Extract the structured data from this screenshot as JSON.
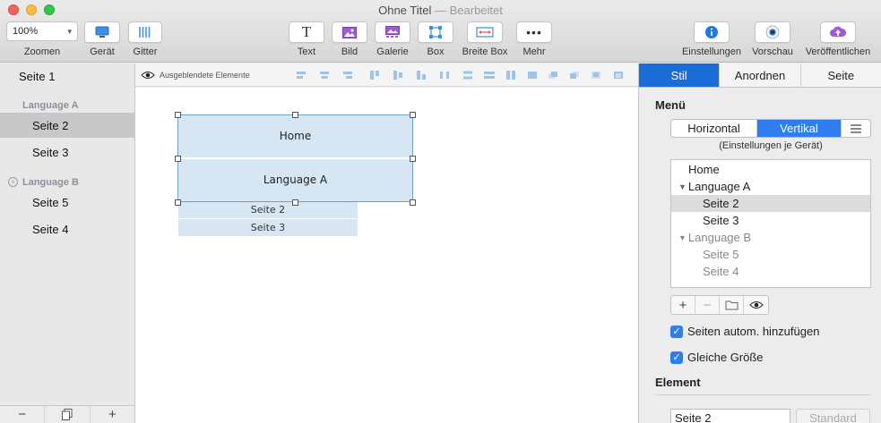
{
  "window": {
    "title": "Ohne Titel",
    "title_sep": " — ",
    "status": "Bearbeitet"
  },
  "toolbar": {
    "zoom_value": "100%",
    "zoom_label": "Zoomen",
    "device_label": "Gerät",
    "grid_label": "Gitter",
    "text_label": "Text",
    "image_label": "Bild",
    "gallery_label": "Galerie",
    "box_label": "Box",
    "wide_box_label": "Breite Box",
    "more_label": "Mehr",
    "settings_label": "Einstellungen",
    "preview_label": "Vorschau",
    "publish_label": "Veröffentlichen"
  },
  "sidebar": {
    "top_page": "Seite 1",
    "group_a": "Language A",
    "group_a_items": [
      "Seite 2",
      "Seite 3"
    ],
    "group_b": "Language B",
    "group_b_items": [
      "Seite 5",
      "Seite 4"
    ],
    "selected": "Seite 2"
  },
  "canvas": {
    "hidden_elements_label": "Ausgeblendete Elemente",
    "menu_items": [
      "Home",
      "Language A"
    ],
    "submenu_items": [
      "Seite 2",
      "Seite 3"
    ],
    "menu_bg": "#d6e6f3"
  },
  "inspector": {
    "tabs": [
      "Stil",
      "Anordnen",
      "Seite"
    ],
    "active_tab": "Stil",
    "menu_title": "Menü",
    "orientation_options": [
      "Horizontal",
      "Vertikal"
    ],
    "orientation_selected": "Vertikal",
    "device_note": "(Einstellungen je Gerät)",
    "tree": {
      "home": "Home",
      "group_a": "Language A",
      "group_a_items": [
        "Seite 2",
        "Seite 3"
      ],
      "group_b": "Language B",
      "group_b_items": [
        "Seite 5",
        "Seite 4"
      ],
      "selected": "Seite 2"
    },
    "auto_add_label": "Seiten autom. hinzufügen",
    "same_size_label": "Gleiche Größe",
    "element_title": "Element",
    "element_value": "Seite 2",
    "standard_label": "Standard",
    "accent": "#2f7ef1"
  }
}
